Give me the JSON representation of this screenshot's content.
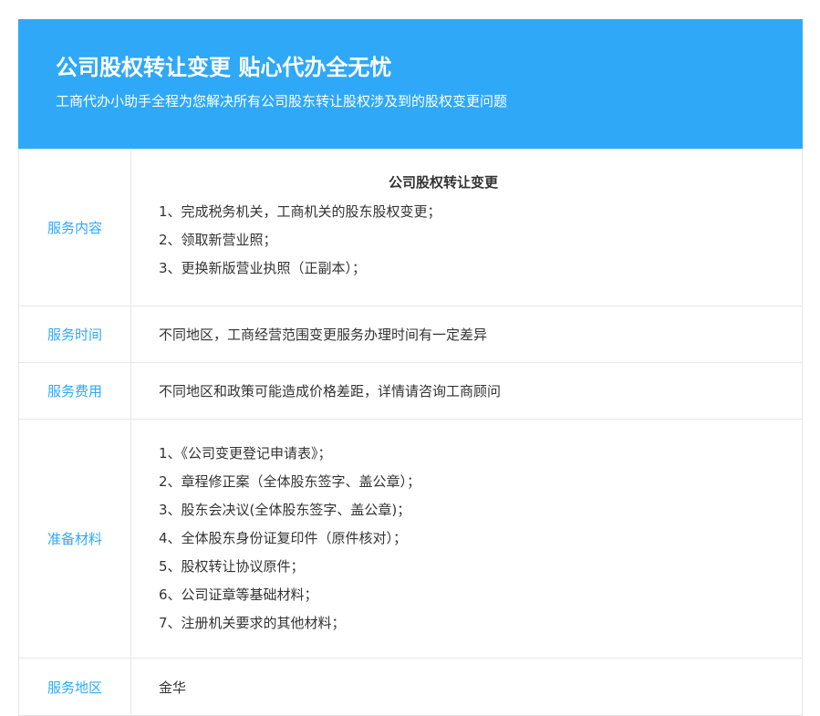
{
  "banner": {
    "title": "公司股权转让变更 贴心代办全无忧",
    "subtitle": "工商代办小助手全程为您解决所有公司股东转让股权涉及到的股权变更问题"
  },
  "rows": {
    "content": {
      "label": "服务内容",
      "heading": "公司股权转让变更",
      "items": [
        "1、完成税务机关，工商机关的股东股权变更；",
        "2、领取新营业照；",
        "3、更换新版营业执照（正副本）；"
      ]
    },
    "time": {
      "label": "服务时间",
      "value": "不同地区，工商经营范围变更服务办理时间有一定差异"
    },
    "fee": {
      "label": "服务费用",
      "value": "不同地区和政策可能造成价格差距，详情请咨询工商顾问"
    },
    "materials": {
      "label": "准备材料",
      "items": [
        "1、《公司变更登记申请表》；",
        "2、章程修正案（全体股东签字、盖公章）；",
        "3、股东会决议(全体股东签字、盖公章)；",
        "4、全体股东身份证复印件（原件核对）；",
        "5、股权转让协议原件；",
        "6、公司证章等基础材料；",
        "7、注册机关要求的其他材料；"
      ]
    },
    "area": {
      "label": "服务地区",
      "value": "金华"
    }
  }
}
